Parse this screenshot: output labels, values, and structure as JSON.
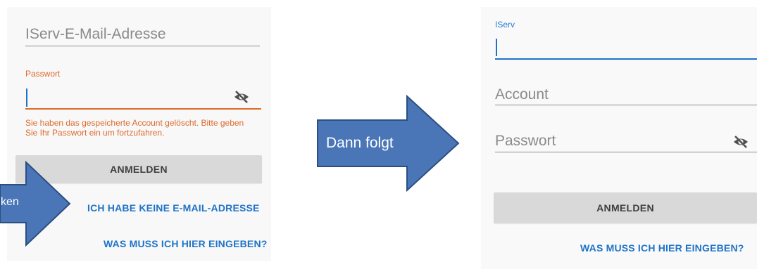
{
  "left_screen": {
    "email_placeholder": "IServ-E-Mail-Adresse",
    "password_label": "Passwort",
    "error_message_line1": "Sie haben das gespeicherte Account gelöscht. Bitte geben",
    "error_message_line2": "Sie Ihr Passwort ein um fortzufahren.",
    "login_button": "ANMELDEN",
    "no_email_link": "ICH HABE KEINE E-MAIL-ADRESSE",
    "help_link": "WAS MUSS ICH HIER EINGEBEN?",
    "password_visibility_icon": "eye-off-icon",
    "colors": {
      "error": "#dd6a2b",
      "link": "#1f73c7",
      "button_bg": "#d9d9d9"
    }
  },
  "right_screen": {
    "server_label": "IServ",
    "account_placeholder": "Account",
    "password_placeholder": "Passwort",
    "login_button": "ANMELDEN",
    "help_link": "WAS MUSS ICH HIER EINGEBEN?",
    "password_visibility_icon": "eye-off-icon",
    "colors": {
      "active_field": "#1f73c7"
    }
  },
  "callouts": {
    "main_arrow_text": "Dann folgt",
    "small_arrow_text": "ken",
    "arrow_color": "#4a76b8",
    "arrow_border": "#2c4f82"
  }
}
